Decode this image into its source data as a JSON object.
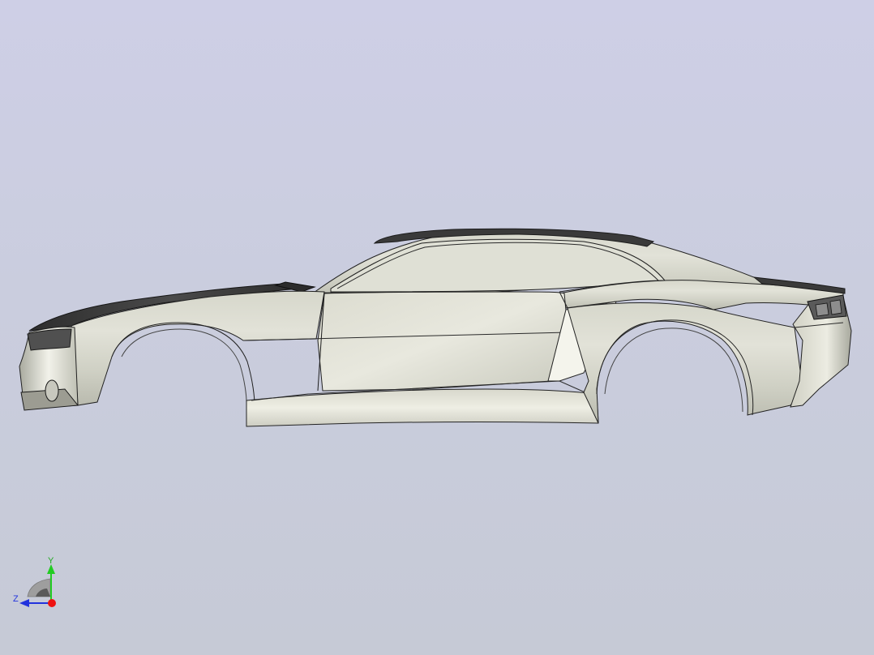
{
  "viewport": {
    "background_top": "#cecfe6",
    "background_bottom": "#c6cad6"
  },
  "model": {
    "icon": "car-body-side-view",
    "body_color": "#e6e6dc",
    "dark_panel_color": "#3c3c3c",
    "edge_color": "#202020"
  },
  "triad": {
    "y_label": "Y",
    "z_label": "Z",
    "y_color": "#22cc22",
    "z_color": "#2233dd",
    "x_color": "#ee1111"
  }
}
